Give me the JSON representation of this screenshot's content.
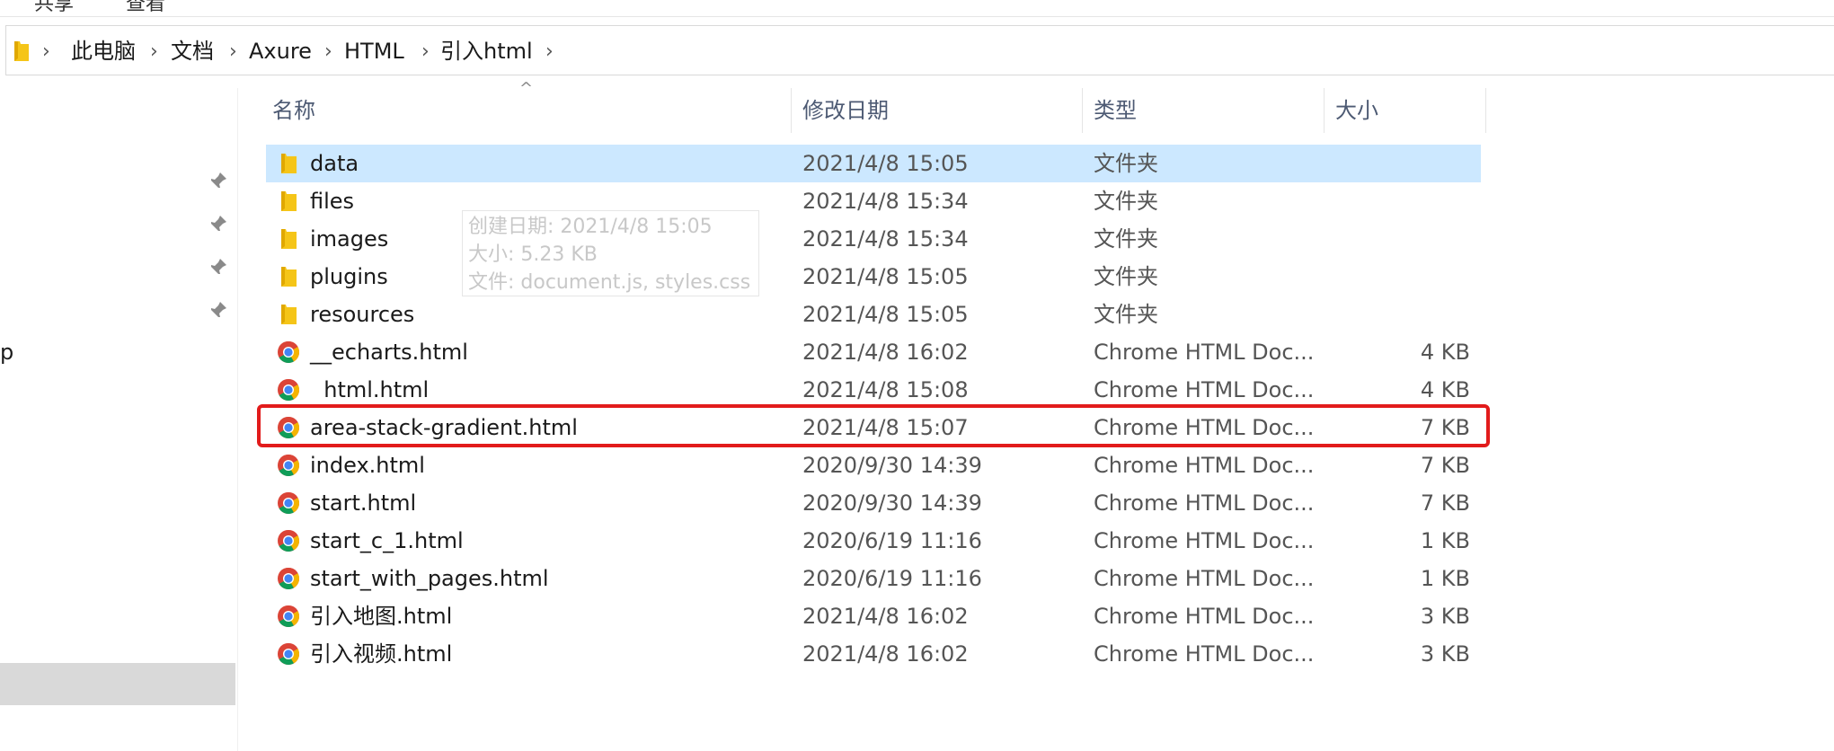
{
  "ribbon": {
    "tabs": [
      "共享",
      "查看"
    ]
  },
  "address": {
    "crumbs": [
      "此电脑",
      "文档",
      "Axure",
      "HTML",
      "引入html"
    ]
  },
  "nav": {
    "partial_label": "p"
  },
  "columns": {
    "name": "名称",
    "modified": "修改日期",
    "type": "类型",
    "size": "大小"
  },
  "tooltip": {
    "created": "创建日期: 2021/4/8 15:05",
    "size": "大小: 5.23 KB",
    "files": "文件: document.js, styles.css"
  },
  "files": [
    {
      "name": "data",
      "date": "2021/4/8 15:05",
      "type": "文件夹",
      "size": "",
      "icon": "folder-icon"
    },
    {
      "name": "files",
      "date": "2021/4/8 15:34",
      "type": "文件夹",
      "size": "",
      "icon": "folder-icon"
    },
    {
      "name": "images",
      "date": "2021/4/8 15:34",
      "type": "文件夹",
      "size": "",
      "icon": "folder-icon"
    },
    {
      "name": "plugins",
      "date": "2021/4/8 15:05",
      "type": "文件夹",
      "size": "",
      "icon": "folder-icon"
    },
    {
      "name": "resources",
      "date": "2021/4/8 15:05",
      "type": "文件夹",
      "size": "",
      "icon": "folder-icon"
    },
    {
      "name": "__echarts.html",
      "date": "2021/4/8 16:02",
      "type": "Chrome HTML Doc...",
      "size": "4 KB",
      "icon": "chrome-icon"
    },
    {
      "name": "  html.html",
      "date": "2021/4/8 15:08",
      "type": "Chrome HTML Doc...",
      "size": "4 KB",
      "icon": "chrome-icon"
    },
    {
      "name": "area-stack-gradient.html",
      "date": "2021/4/8 15:07",
      "type": "Chrome HTML Doc...",
      "size": "7 KB",
      "icon": "chrome-icon"
    },
    {
      "name": "index.html",
      "date": "2020/9/30 14:39",
      "type": "Chrome HTML Doc...",
      "size": "7 KB",
      "icon": "chrome-icon"
    },
    {
      "name": "start.html",
      "date": "2020/9/30 14:39",
      "type": "Chrome HTML Doc...",
      "size": "7 KB",
      "icon": "chrome-icon"
    },
    {
      "name": "start_c_1.html",
      "date": "2020/6/19 11:16",
      "type": "Chrome HTML Doc...",
      "size": "1 KB",
      "icon": "chrome-icon"
    },
    {
      "name": "start_with_pages.html",
      "date": "2020/6/19 11:16",
      "type": "Chrome HTML Doc...",
      "size": "1 KB",
      "icon": "chrome-icon"
    },
    {
      "name": "引入地图.html",
      "date": "2021/4/8 16:02",
      "type": "Chrome HTML Doc...",
      "size": "3 KB",
      "icon": "chrome-icon"
    },
    {
      "name": "引入视频.html",
      "date": "2021/4/8 16:02",
      "type": "Chrome HTML Doc...",
      "size": "3 KB",
      "icon": "chrome-icon"
    }
  ],
  "selected_index": 0,
  "highlighted_index": 7,
  "colors": {
    "selection": "#cce8ff",
    "highlight_border": "#e21b1b",
    "folder": "#f5c518",
    "header_text": "#4d5a73"
  }
}
